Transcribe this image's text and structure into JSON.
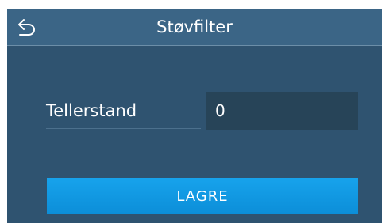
{
  "header": {
    "title": "Støvfilter",
    "back_icon": "back-arrow-icon"
  },
  "form": {
    "counter_label": "Tellerstand",
    "counter_value": "0"
  },
  "actions": {
    "save_label": "LAGRE",
    "save_color": "#1199e2"
  },
  "colors": {
    "background": "#2f5370",
    "header": "#3b6586",
    "input": "#274458"
  }
}
